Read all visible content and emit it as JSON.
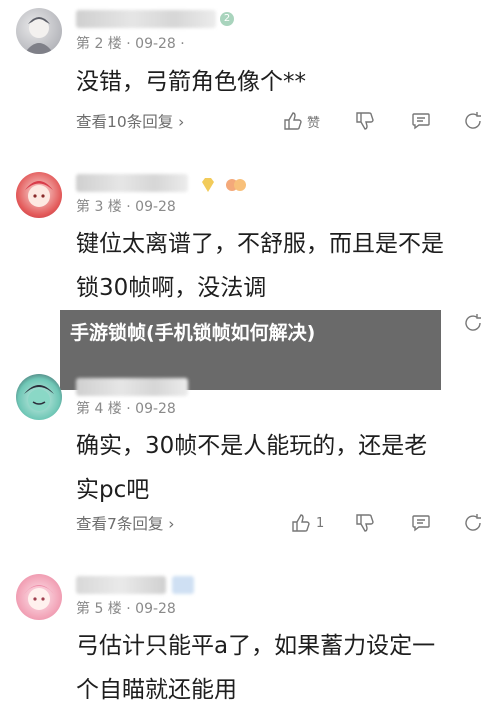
{
  "overlay": {
    "title": "手游锁帧(手机锁帧如何解决)"
  },
  "comments": [
    {
      "meta": "第 2 楼 · 09-28 ·",
      "lines": [
        "没错，弓箭角色像个**"
      ],
      "replies": "查看10条回复 ›",
      "like_label": "赞",
      "badge": "2"
    },
    {
      "meta": "第 3 楼 · 09-28",
      "lines": [
        "键位太离谱了，不舒服，而且是不是",
        "锁30帧啊，没法调"
      ]
    },
    {
      "meta": "第 4 楼 · 09-28",
      "lines": [
        "确实，30帧不是人能玩的，还是老",
        "实pc吧"
      ],
      "replies": "查看7条回复 ›",
      "like_count": "1"
    },
    {
      "meta": "第 5 楼 · 09-28",
      "lines": [
        "弓估计只能平a了，如果蓄力设定一",
        "个自瞄就还能用"
      ]
    }
  ],
  "colors": {
    "accent_badge": "#9ad0b0"
  }
}
